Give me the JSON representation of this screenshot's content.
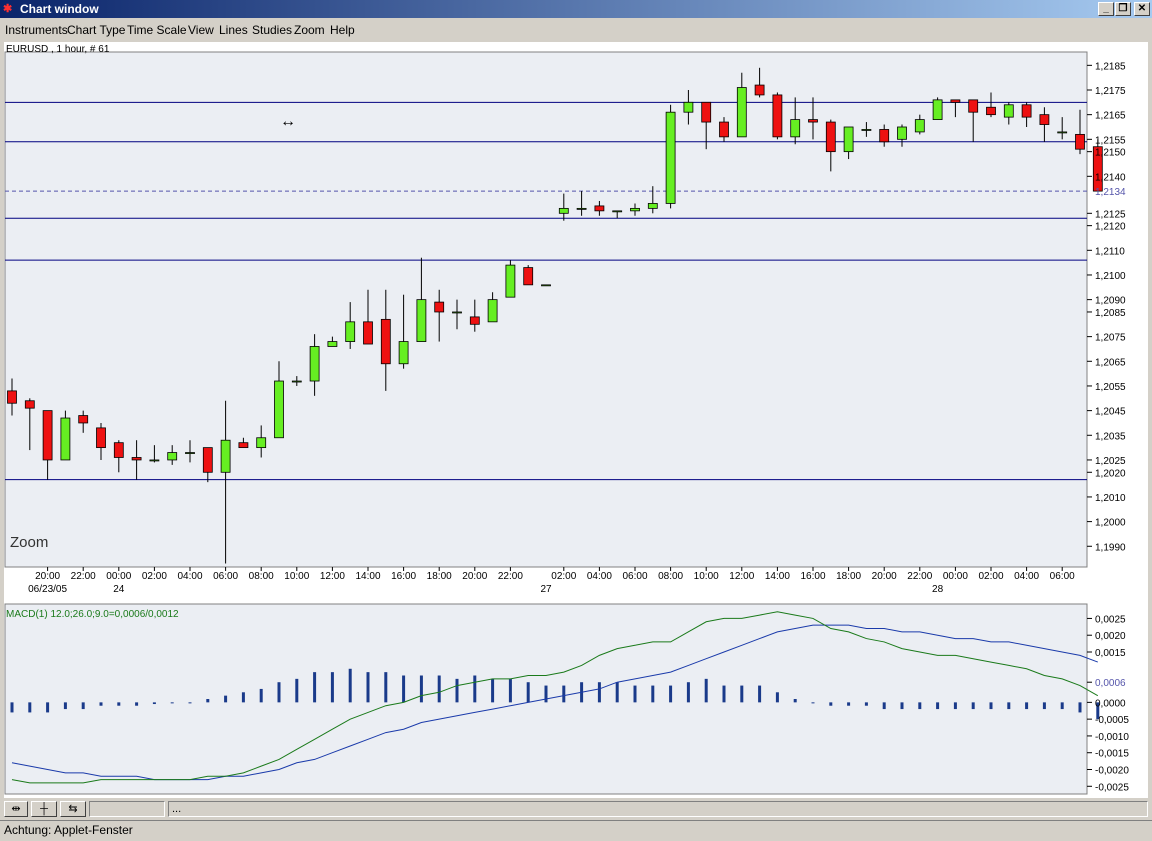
{
  "window": {
    "title": "Chart window",
    "logo": "✱",
    "min_glyph": "_",
    "max_glyph": "❐",
    "close_glyph": "✕"
  },
  "menu": [
    "Instruments",
    "Chart Type",
    "Time Scale",
    "View",
    "Lines",
    "Studies",
    "Zoom",
    "Help"
  ],
  "price_chart": {
    "label": "EURUSD , 1 hour, # 61",
    "zoom_label": "Zoom",
    "cursor_glyph": "↔",
    "current_price": "1,2134",
    "y_ticks": [
      "1,2185",
      "1,2175",
      "1,2165",
      "1,2155",
      "1,2150",
      "1,2140",
      "1,2125",
      "1,2120",
      "1,2110",
      "1,2100",
      "1,2090",
      "1,2085",
      "1,2075",
      "1,2065",
      "1,2055",
      "1,2045",
      "1,2035",
      "1,2025",
      "1,2020",
      "1,2010",
      "1,2000",
      "1,1990"
    ],
    "x_ticks": [
      "20:00",
      "22:00",
      "00:00",
      "02:00",
      "04:00",
      "06:00",
      "08:00",
      "10:00",
      "12:00",
      "14:00",
      "16:00",
      "18:00",
      "20:00",
      "22:00",
      "02:00",
      "04:00",
      "06:00",
      "08:00",
      "10:00",
      "12:00",
      "14:00",
      "16:00",
      "18:00",
      "20:00",
      "22:00",
      "00:00",
      "02:00",
      "04:00",
      "06:00"
    ],
    "date_labels": [
      "06/23/05",
      "24",
      "27",
      "28"
    ],
    "colors": {
      "up": "#66ee22",
      "down": "#ee1111",
      "line": "#000080",
      "dashed": "#5555aa"
    }
  },
  "macd_chart": {
    "label": "MACD(1) 12.0;26.0;9.0=0,0006/0,0012",
    "y_ticks": [
      "0,0025",
      "0,0020",
      "0,0015",
      "0,0006",
      "0,0000",
      "-0,0005",
      "-0,0010",
      "-0,0015",
      "-0,0020",
      "-0,0025"
    ],
    "colors": {
      "bars": "#1a3a8a",
      "macd": "#1a3aaa",
      "signal": "#1a7a1a"
    }
  },
  "chart_data": [
    {
      "type": "candlestick",
      "title": "EURUSD , 1 hour, # 61",
      "ylim": [
        1.1982,
        1.219
      ],
      "candles": [
        {
          "o": 1.2053,
          "h": 1.2058,
          "l": 1.2043,
          "c": 1.2048
        },
        {
          "o": 1.2049,
          "h": 1.205,
          "l": 1.2029,
          "c": 1.2046
        },
        {
          "o": 1.2045,
          "h": 1.2045,
          "l": 1.2017,
          "c": 1.2025
        },
        {
          "o": 1.2025,
          "h": 1.2045,
          "l": 1.2025,
          "c": 1.2042
        },
        {
          "o": 1.2043,
          "h": 1.2045,
          "l": 1.2036,
          "c": 1.204
        },
        {
          "o": 1.2038,
          "h": 1.204,
          "l": 1.2025,
          "c": 1.203
        },
        {
          "o": 1.2032,
          "h": 1.2033,
          "l": 1.202,
          "c": 1.2026
        },
        {
          "o": 1.2026,
          "h": 1.2033,
          "l": 1.2017,
          "c": 1.2025
        },
        {
          "o": 1.2025,
          "h": 1.2031,
          "l": 1.2024,
          "c": 1.2025
        },
        {
          "o": 1.2025,
          "h": 1.2031,
          "l": 1.2023,
          "c": 1.2028
        },
        {
          "o": 1.2028,
          "h": 1.2033,
          "l": 1.2024,
          "c": 1.2028
        },
        {
          "o": 1.203,
          "h": 1.203,
          "l": 1.2016,
          "c": 1.202
        },
        {
          "o": 1.202,
          "h": 1.2049,
          "l": 1.1983,
          "c": 1.2033
        },
        {
          "o": 1.2032,
          "h": 1.2034,
          "l": 1.203,
          "c": 1.203
        },
        {
          "o": 1.203,
          "h": 1.2039,
          "l": 1.2026,
          "c": 1.2034
        },
        {
          "o": 1.2034,
          "h": 1.2065,
          "l": 1.2034,
          "c": 1.2057
        },
        {
          "o": 1.2057,
          "h": 1.2059,
          "l": 1.2055,
          "c": 1.2057
        },
        {
          "o": 1.2057,
          "h": 1.2076,
          "l": 1.2051,
          "c": 1.2071
        },
        {
          "o": 1.2071,
          "h": 1.2075,
          "l": 1.2071,
          "c": 1.2073
        },
        {
          "o": 1.2073,
          "h": 1.2089,
          "l": 1.207,
          "c": 1.2081
        },
        {
          "o": 1.2081,
          "h": 1.2094,
          "l": 1.2072,
          "c": 1.2072
        },
        {
          "o": 1.2082,
          "h": 1.2094,
          "l": 1.2053,
          "c": 1.2064
        },
        {
          "o": 1.2064,
          "h": 1.2092,
          "l": 1.2062,
          "c": 1.2073
        },
        {
          "o": 1.2073,
          "h": 1.2107,
          "l": 1.2073,
          "c": 1.209
        },
        {
          "o": 1.2089,
          "h": 1.2094,
          "l": 1.2073,
          "c": 1.2085
        },
        {
          "o": 1.2085,
          "h": 1.209,
          "l": 1.2078,
          "c": 1.2085
        },
        {
          "o": 1.2083,
          "h": 1.209,
          "l": 1.2077,
          "c": 1.208
        },
        {
          "o": 1.2081,
          "h": 1.2093,
          "l": 1.2081,
          "c": 1.209
        },
        {
          "o": 1.2091,
          "h": 1.2106,
          "l": 1.2091,
          "c": 1.2104
        },
        {
          "o": 1.2103,
          "h": 1.2104,
          "l": 1.2096,
          "c": 1.2096
        },
        {
          "o": 1.2096,
          "h": 1.2096,
          "l": 1.2096,
          "c": 1.2096
        },
        {
          "o": 1.2125,
          "h": 1.2133,
          "l": 1.2122,
          "c": 1.2127
        },
        {
          "o": 1.2127,
          "h": 1.2134,
          "l": 1.2124,
          "c": 1.2127
        },
        {
          "o": 1.2128,
          "h": 1.213,
          "l": 1.2124,
          "c": 1.2126
        },
        {
          "o": 1.2126,
          "h": 1.2126,
          "l": 1.2123,
          "c": 1.2126
        },
        {
          "o": 1.2126,
          "h": 1.2129,
          "l": 1.2124,
          "c": 1.2127
        },
        {
          "o": 1.2127,
          "h": 1.2136,
          "l": 1.2125,
          "c": 1.2129
        },
        {
          "o": 1.2129,
          "h": 1.2169,
          "l": 1.2127,
          "c": 1.2166
        },
        {
          "o": 1.2166,
          "h": 1.2175,
          "l": 1.2161,
          "c": 1.217
        },
        {
          "o": 1.217,
          "h": 1.217,
          "l": 1.2151,
          "c": 1.2162
        },
        {
          "o": 1.2162,
          "h": 1.2164,
          "l": 1.2154,
          "c": 1.2156
        },
        {
          "o": 1.2156,
          "h": 1.2182,
          "l": 1.2156,
          "c": 1.2176
        },
        {
          "o": 1.2177,
          "h": 1.2184,
          "l": 1.2172,
          "c": 1.2173
        },
        {
          "o": 1.2173,
          "h": 1.2174,
          "l": 1.2155,
          "c": 1.2156
        },
        {
          "o": 1.2156,
          "h": 1.2172,
          "l": 1.2153,
          "c": 1.2163
        },
        {
          "o": 1.2163,
          "h": 1.2172,
          "l": 1.2155,
          "c": 1.2162
        },
        {
          "o": 1.2162,
          "h": 1.2163,
          "l": 1.2142,
          "c": 1.215
        },
        {
          "o": 1.215,
          "h": 1.216,
          "l": 1.2147,
          "c": 1.216
        },
        {
          "o": 1.2159,
          "h": 1.2162,
          "l": 1.2156,
          "c": 1.2159
        },
        {
          "o": 1.2159,
          "h": 1.2161,
          "l": 1.2152,
          "c": 1.2154
        },
        {
          "o": 1.2155,
          "h": 1.2161,
          "l": 1.2152,
          "c": 1.216
        },
        {
          "o": 1.2158,
          "h": 1.2165,
          "l": 1.2157,
          "c": 1.2163
        },
        {
          "o": 1.2163,
          "h": 1.2172,
          "l": 1.2163,
          "c": 1.2171
        },
        {
          "o": 1.2171,
          "h": 1.2171,
          "l": 1.2164,
          "c": 1.217
        },
        {
          "o": 1.2171,
          "h": 1.2171,
          "l": 1.2154,
          "c": 1.2166
        },
        {
          "o": 1.2168,
          "h": 1.2174,
          "l": 1.2164,
          "c": 1.2165
        },
        {
          "o": 1.2164,
          "h": 1.217,
          "l": 1.2161,
          "c": 1.2169
        },
        {
          "o": 1.2169,
          "h": 1.217,
          "l": 1.216,
          "c": 1.2164
        },
        {
          "o": 1.2165,
          "h": 1.2168,
          "l": 1.2154,
          "c": 1.2161
        },
        {
          "o": 1.2158,
          "h": 1.2164,
          "l": 1.2155,
          "c": 1.2158
        },
        {
          "o": 1.2157,
          "h": 1.2167,
          "l": 1.2149,
          "c": 1.2151
        },
        {
          "o": 1.2152,
          "h": 1.2155,
          "l": 1.2134,
          "c": 1.2134
        }
      ],
      "hlines": [
        1.217,
        1.2154,
        1.2123,
        1.2106,
        1.2017
      ],
      "dashed_line": 1.2134
    },
    {
      "type": "bar",
      "title": "MACD(1) 12.0;26.0;9.0=0,0006/0,0012",
      "ylim": [
        -0.0027,
        0.0029
      ],
      "histogram": [
        -0.0003,
        -0.0003,
        -0.0003,
        -0.0002,
        -0.0002,
        -0.0001,
        -0.0001,
        -0.0001,
        -5e-05,
        0,
        0,
        0.0001,
        0.0002,
        0.0003,
        0.0004,
        0.0006,
        0.0007,
        0.0009,
        0.0009,
        0.001,
        0.0009,
        0.0009,
        0.0008,
        0.0008,
        0.0008,
        0.0007,
        0.0008,
        0.0007,
        0.0007,
        0.0006,
        0.0005,
        0.0005,
        0.0006,
        0.0006,
        0.0006,
        0.0005,
        0.0005,
        0.0005,
        0.0006,
        0.0007,
        0.0005,
        0.0005,
        0.0005,
        0.0003,
        0.0001,
        0,
        -0.0001,
        -0.0001,
        -0.0001,
        -0.0002,
        -0.0002,
        -0.0002,
        -0.0002,
        -0.0002,
        -0.0002,
        -0.0002,
        -0.0002,
        -0.0002,
        -0.0002,
        -0.0002,
        -0.0003,
        -0.0005
      ],
      "macd_line": [
        -0.0018,
        -0.0019,
        -0.002,
        -0.0021,
        -0.0021,
        -0.0022,
        -0.0022,
        -0.0022,
        -0.0023,
        -0.0023,
        -0.0023,
        -0.0023,
        -0.0022,
        -0.0022,
        -0.0021,
        -0.002,
        -0.0018,
        -0.0017,
        -0.0015,
        -0.0013,
        -0.0011,
        -0.0009,
        -0.0008,
        -0.0006,
        -0.0005,
        -0.0004,
        -0.0003,
        -0.0002,
        -0.0001,
        0,
        0.0001,
        0.0002,
        0.0003,
        0.0004,
        0.0006,
        0.0007,
        0.0008,
        0.0009,
        0.0011,
        0.0013,
        0.0015,
        0.0017,
        0.0019,
        0.0021,
        0.0022,
        0.0023,
        0.0023,
        0.0023,
        0.0022,
        0.0022,
        0.0021,
        0.0021,
        0.002,
        0.0019,
        0.0019,
        0.0018,
        0.0018,
        0.0017,
        0.0016,
        0.0015,
        0.0014,
        0.0012
      ],
      "signal_line": [
        -0.0023,
        -0.0024,
        -0.0024,
        -0.0024,
        -0.0024,
        -0.0023,
        -0.0023,
        -0.0023,
        -0.0023,
        -0.0023,
        -0.0023,
        -0.0022,
        -0.0022,
        -0.0021,
        -0.0019,
        -0.0017,
        -0.0014,
        -0.0011,
        -0.0008,
        -0.0005,
        -0.0003,
        -0.0001,
        0,
        0.0002,
        0.0003,
        0.0005,
        0.0006,
        0.0007,
        0.0007,
        0.0008,
        0.0008,
        0.0009,
        0.0011,
        0.0014,
        0.0016,
        0.0017,
        0.0018,
        0.0018,
        0.0021,
        0.0024,
        0.0025,
        0.0025,
        0.0026,
        0.0027,
        0.0026,
        0.0025,
        0.0022,
        0.0021,
        0.0019,
        0.0018,
        0.0016,
        0.0015,
        0.0014,
        0.0014,
        0.0013,
        0.0012,
        0.0011,
        0.001,
        0.0008,
        0.0007,
        0.0005,
        0.0002
      ]
    }
  ],
  "status": {
    "btn1": "⇹",
    "btn2": "┼",
    "btn3": "⇆",
    "field_right": "...",
    "applet_text": "Achtung: Applet-Fenster"
  }
}
